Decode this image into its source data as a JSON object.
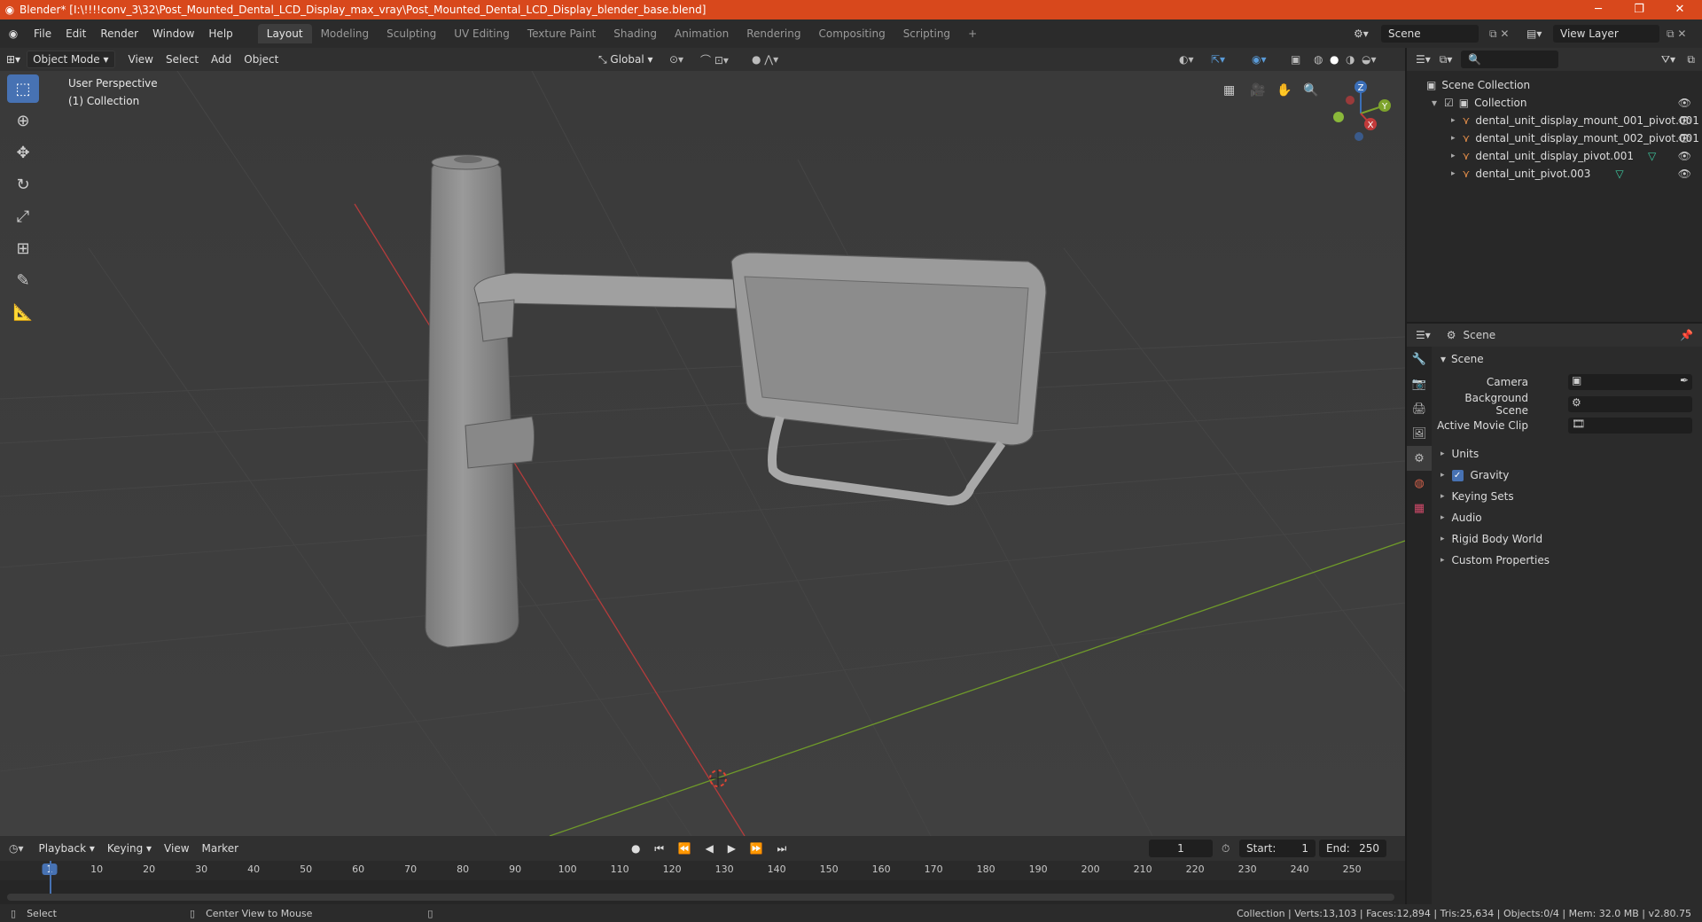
{
  "window": {
    "title": "Blender* [I:\\!!!!conv_3\\32\\Post_Mounted_Dental_LCD_Display_max_vray\\Post_Mounted_Dental_LCD_Display_blender_base.blend]",
    "minimize": "─",
    "maximize": "❐",
    "close": "✕"
  },
  "menus": [
    "File",
    "Edit",
    "Render",
    "Window",
    "Help"
  ],
  "workspaces": [
    "Layout",
    "Modeling",
    "Sculpting",
    "UV Editing",
    "Texture Paint",
    "Shading",
    "Animation",
    "Rendering",
    "Compositing",
    "Scripting"
  ],
  "workspace_add": "+",
  "scene_field": "Scene",
  "view_layer_field": "View Layer",
  "viewport": {
    "mode": "Object Mode",
    "menus": [
      "View",
      "Select",
      "Add",
      "Object"
    ],
    "transform": "Global",
    "info_line1": "User Perspective",
    "info_line2": "(1) Collection",
    "gizmo": {
      "z": "Z",
      "y": "Y",
      "x": "X"
    }
  },
  "outliner": {
    "root": "Scene Collection",
    "collection": "Collection",
    "items": [
      {
        "name": "dental_unit_display_mount_001_pivot.001",
        "has_mesh": false
      },
      {
        "name": "dental_unit_display_mount_002_pivot.001",
        "has_mesh": false
      },
      {
        "name": "dental_unit_display_pivot.001",
        "has_mesh": true
      },
      {
        "name": "dental_unit_pivot.003",
        "has_mesh": true
      }
    ]
  },
  "properties": {
    "context": "Scene",
    "panel": "Scene",
    "camera_label": "Camera",
    "bg_scene_label": "Background Scene",
    "movie_clip_label": "Active Movie Clip",
    "sections": [
      "Units",
      "Gravity",
      "Keying Sets",
      "Audio",
      "Rigid Body World",
      "Custom Properties"
    ]
  },
  "timeline": {
    "menus": [
      "Playback",
      "Keying",
      "View",
      "Marker"
    ],
    "current_frame": "1",
    "start_label": "Start:",
    "start": "1",
    "end_label": "End:",
    "end": "250",
    "ticks": [
      "1",
      "10",
      "20",
      "30",
      "40",
      "50",
      "60",
      "70",
      "80",
      "90",
      "100",
      "110",
      "120",
      "130",
      "140",
      "150",
      "160",
      "170",
      "180",
      "190",
      "200",
      "210",
      "220",
      "230",
      "240",
      "250"
    ]
  },
  "status": {
    "select": "Select",
    "center_view": "Center View to Mouse",
    "stats": "Collection | Verts:13,103 | Faces:12,894 | Tris:25,634 | Objects:0/4 | Mem: 32.0 MB | v2.80.75"
  },
  "colors": {
    "accent": "#4772b3",
    "titlebar": "#d8481c",
    "x_axis": "#c23a3a",
    "y_axis": "#7da32c"
  }
}
